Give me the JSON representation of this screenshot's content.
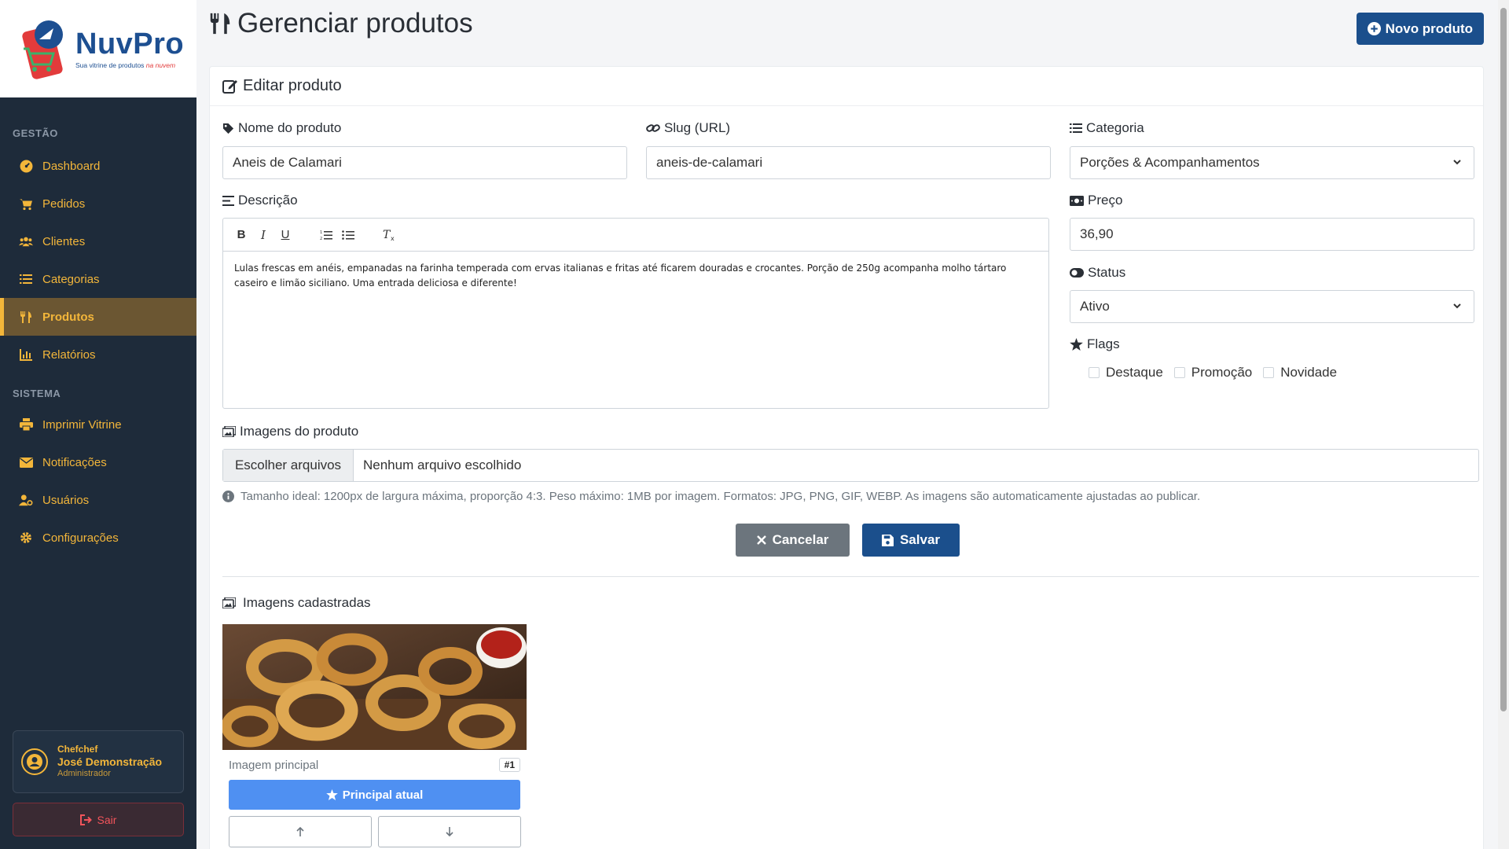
{
  "brand": {
    "name": "NuvPro",
    "tagline_a": "Sua vitrine de produtos ",
    "tagline_b": "na nuvem"
  },
  "sidebar": {
    "section_gestao": "GESTÃO",
    "section_sistema": "SISTEMA",
    "items": [
      {
        "label": "Dashboard",
        "icon": "dashboard-icon"
      },
      {
        "label": "Pedidos",
        "icon": "cart-icon"
      },
      {
        "label": "Clientes",
        "icon": "users-icon"
      },
      {
        "label": "Categorias",
        "icon": "list-icon"
      },
      {
        "label": "Produtos",
        "icon": "utensils-icon"
      },
      {
        "label": "Relatórios",
        "icon": "chart-icon"
      },
      {
        "label": "Imprimir Vitrine",
        "icon": "print-icon"
      },
      {
        "label": "Notificações",
        "icon": "envelope-icon"
      },
      {
        "label": "Usuários",
        "icon": "user-cog-icon"
      },
      {
        "label": "Configurações",
        "icon": "gear-icon"
      }
    ],
    "user": {
      "company": "Chefchef",
      "name": "José Demonstração",
      "role": "Administrador"
    },
    "logout_label": "Sair"
  },
  "header": {
    "title": "Gerenciar produtos",
    "new_button": "Novo produto"
  },
  "form": {
    "card_title": "Editar produto",
    "name_label": "Nome do produto",
    "name_value": "Aneis de Calamari",
    "slug_label": "Slug (URL)",
    "slug_value": "aneis-de-calamari",
    "category_label": "Categoria",
    "category_value": "Porções & Acompanhamentos",
    "description_label": "Descrição",
    "description_value": "Lulas frescas em anéis, empanadas na farinha temperada com ervas italianas e fritas até ficarem douradas e crocantes. Porção de 250g acompanha molho tártaro caseiro e limão siciliano. Uma entrada deliciosa e diferente!",
    "price_label": "Preço",
    "price_value": "36,90",
    "status_label": "Status",
    "status_value": "Ativo",
    "flags_label": "Flags",
    "flag_destaque": "Destaque",
    "flag_promocao": "Promoção",
    "flag_novidade": "Novidade",
    "images_label": "Imagens do produto",
    "file_button": "Escolher arquivos",
    "file_none": "Nenhum arquivo escolhido",
    "images_hint": "Tamanho ideal: 1200px de largura máxima, proporção 4:3. Peso máximo: 1MB por imagem. Formatos: JPG, PNG, GIF, WEBP. As imagens são automaticamente ajustadas ao publicar.",
    "cancel_label": "Cancelar",
    "save_label": "Salvar"
  },
  "gallery": {
    "title": "Imagens cadastradas",
    "image_caption": "Imagem principal",
    "image_index": "#1",
    "principal_label": "Principal atual"
  },
  "colors": {
    "sidebar_bg": "#1e2b3a",
    "accent": "#f3b63a",
    "primary": "#1b4f8c",
    "principal_btn": "#4f90f2"
  }
}
